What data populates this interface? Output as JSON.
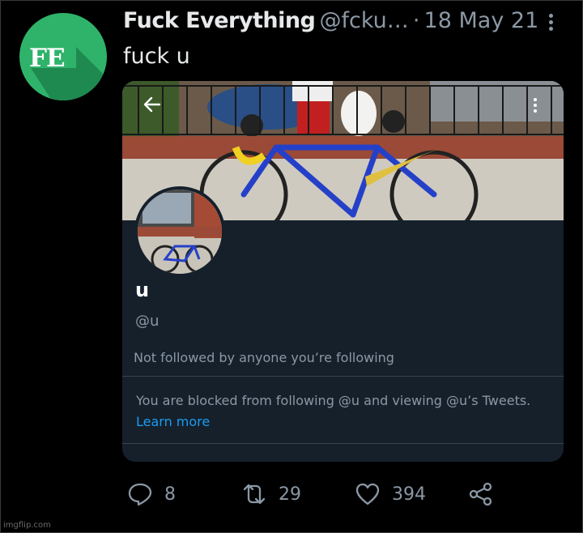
{
  "tweet": {
    "author_name": "Fuck Everything",
    "author_handle": "@fcku…",
    "separator": "·",
    "date": "18 May 21",
    "text": "fuck u",
    "avatar_initials": "FE"
  },
  "card": {
    "profile_name": "u",
    "profile_handle": "@u",
    "not_followed": "Not followed by anyone you’re following",
    "blocked_message": "You are blocked from following @u and viewing @u’s Tweets.",
    "learn_more": "Learn more"
  },
  "actions": {
    "replies": "8",
    "retweets": "29",
    "likes": "394"
  },
  "watermark": "imgflip.com",
  "colors": {
    "background": "#000000",
    "avatar_green": "#2fb36b",
    "card_bg": "#15202b",
    "link_blue": "#1d9bf0",
    "muted": "#8b98a5"
  },
  "icons": [
    "reply-icon",
    "retweet-icon",
    "like-icon",
    "share-icon",
    "back-arrow-icon",
    "more-icon"
  ]
}
